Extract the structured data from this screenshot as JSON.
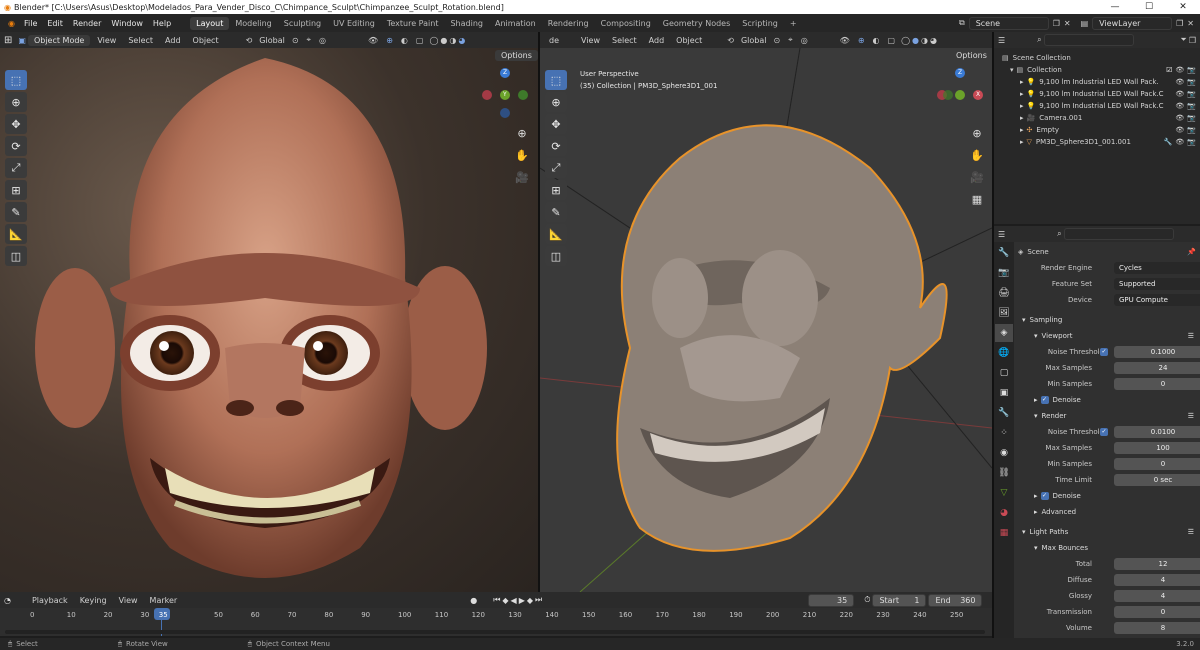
{
  "window": {
    "title": "Blender* [C:\\Users\\Asus\\Desktop\\Modelados_Para_Vender_Disco_C\\Chimpance_Sculpt\\Chimpanzee_Sculpt_Rotation.blend]",
    "minimize": "—",
    "maximize": "☐",
    "close": "✕"
  },
  "menu": {
    "items": [
      "File",
      "Edit",
      "Render",
      "Window",
      "Help"
    ]
  },
  "workspaces": [
    "Layout",
    "Modeling",
    "Sculpting",
    "UV Editing",
    "Texture Paint",
    "Shading",
    "Animation",
    "Rendering",
    "Compositing",
    "Geometry Nodes",
    "Scripting"
  ],
  "workspace_add": "+",
  "scene": {
    "name": "Scene",
    "view_layer": "ViewLayer"
  },
  "viewport_left": {
    "mode": "Object Mode",
    "menus": [
      "View",
      "Select",
      "Add",
      "Object"
    ],
    "orientation": "Global",
    "options": "Options"
  },
  "viewport_right": {
    "mode_partial": "de",
    "menus": [
      "View",
      "Select",
      "Add",
      "Object"
    ],
    "orientation": "Global",
    "options": "Options",
    "info_line1": "User Perspective",
    "info_line2": "(35) Collection | PM3D_Sphere3D1_001"
  },
  "gizmo": {
    "x": "X",
    "y": "Y",
    "z": "Z"
  },
  "outliner": {
    "root": "Scene Collection",
    "collection": "Collection",
    "items": [
      "9,100 lm Industrial LED Wall Pack.",
      "9,100 lm Industrial LED Wall Pack.C",
      "9,100 lm Industrial LED Wall Pack.C",
      "Camera.001",
      "Empty",
      "PM3D_Sphere3D1_001.001"
    ]
  },
  "properties": {
    "context": "Scene",
    "render_engine_label": "Render Engine",
    "render_engine": "Cycles",
    "feature_set_label": "Feature Set",
    "feature_set": "Supported",
    "device_label": "Device",
    "device": "GPU Compute",
    "sampling": "Sampling",
    "viewport": "Viewport",
    "vp_noise_label": "Noise Threshold",
    "vp_noise": "0.1000",
    "vp_max_label": "Max Samples",
    "vp_max": "24",
    "vp_min_label": "Min Samples",
    "vp_min": "0",
    "denoise": "Denoise",
    "render": "Render",
    "r_noise_label": "Noise Threshold",
    "r_noise": "0.0100",
    "r_max_label": "Max Samples",
    "r_max": "100",
    "r_min_label": "Min Samples",
    "r_min": "0",
    "r_time_label": "Time Limit",
    "r_time": "0 sec",
    "denoise2": "Denoise",
    "advanced": "Advanced",
    "light_paths": "Light Paths",
    "max_bounces": "Max Bounces",
    "total_label": "Total",
    "total": "12",
    "diffuse_label": "Diffuse",
    "diffuse": "4",
    "glossy_label": "Glossy",
    "glossy": "4",
    "transmission_label": "Transmission",
    "transmission": "0",
    "volume_label": "Volume",
    "volume": "8"
  },
  "timeline": {
    "menus": [
      "Playback",
      "Keying",
      "View",
      "Marker"
    ],
    "current_frame": "35",
    "start_label": "Start",
    "start": "1",
    "end_label": "End",
    "end": "360",
    "ticks": [
      "0",
      "10",
      "20",
      "30",
      "35",
      "50",
      "60",
      "70",
      "80",
      "90",
      "100",
      "110",
      "120",
      "130",
      "140",
      "150",
      "160",
      "170",
      "180",
      "190",
      "200",
      "210",
      "220",
      "230",
      "240",
      "250"
    ]
  },
  "statusbar": {
    "select": "Select",
    "rotate": "Rotate View",
    "context": "Object Context Menu",
    "version": "3.2.0"
  },
  "colors": {
    "accent": "#4772b3",
    "header": "#2b2b2b",
    "panel": "#303030",
    "selected_outline": "#e8932a"
  }
}
